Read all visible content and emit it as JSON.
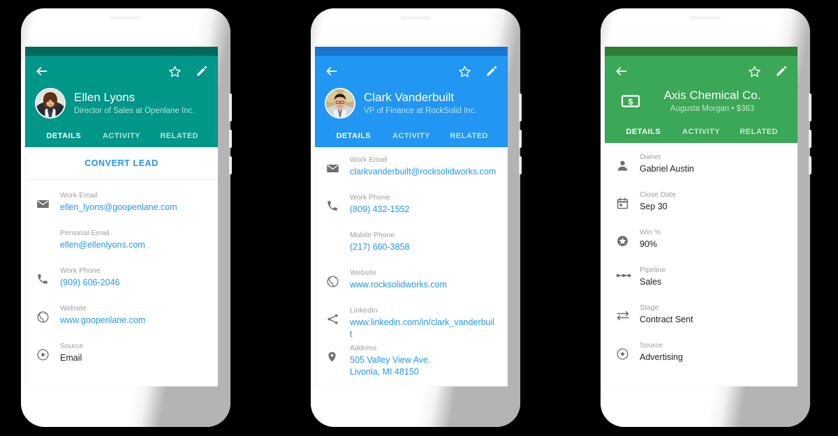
{
  "background_color": "#000000",
  "phones": [
    {
      "id": "lead-ellen-lyons",
      "theme": {
        "primary": "#009688",
        "status_bar": "#00695c"
      },
      "appbar": {
        "back_label": "Back",
        "star_label": "Favorite",
        "edit_label": "Edit"
      },
      "identity": {
        "kind": "avatar",
        "name": "Ellen Lyons",
        "subtitle": "Director of Sales at Openlane Inc."
      },
      "tabs": [
        {
          "label": "DETAILS",
          "active": true
        },
        {
          "label": "ACTIVITY",
          "active": false
        },
        {
          "label": "RELATED",
          "active": false
        }
      ],
      "action_row": {
        "label": "CONVERT LEAD",
        "color": "#2196f3"
      },
      "fields": [
        {
          "icon": "mail-icon",
          "label": "Work Email",
          "value": "ellen_lyons@goopenlane.com",
          "style": "link"
        },
        {
          "icon": "none",
          "label": "Personal Email",
          "value": "ellen@ellenlyons.com",
          "style": "link"
        },
        {
          "icon": "phone-icon",
          "label": "Work Phone",
          "value": "(909) 606-2046",
          "style": "link"
        },
        {
          "icon": "globe-icon",
          "label": "Website",
          "value": "www.goopenlane.com",
          "style": "link"
        },
        {
          "icon": "source-icon",
          "label": "Source",
          "value": "Email",
          "style": "plain"
        }
      ]
    },
    {
      "id": "contact-clark-vanderbuilt",
      "theme": {
        "primary": "#2196f3",
        "status_bar": "#1976d2"
      },
      "appbar": {
        "back_label": "Back",
        "star_label": "Favorite",
        "edit_label": "Edit"
      },
      "identity": {
        "kind": "avatar",
        "name": "Clark Vanderbuilt",
        "subtitle": "VP of Finance at RockSolid Inc."
      },
      "tabs": [
        {
          "label": "DETAILS",
          "active": true
        },
        {
          "label": "ACTIVITY",
          "active": false
        },
        {
          "label": "RELATED",
          "active": false
        }
      ],
      "action_row": null,
      "fields": [
        {
          "icon": "mail-icon",
          "label": "Work Email",
          "value": "clarkvanderbuilt@rocksolidworks.com",
          "style": "link"
        },
        {
          "icon": "phone-icon",
          "label": "Work Phone",
          "value": "(809) 432-1552",
          "style": "link"
        },
        {
          "icon": "none",
          "label": "Mobile Phone",
          "value": "(217) 660-3858",
          "style": "link"
        },
        {
          "icon": "globe-icon",
          "label": "Website",
          "value": "www.rocksolidworks.com",
          "style": "link"
        },
        {
          "icon": "share-icon",
          "label": "LinkedIn",
          "value": "www.linkedin.com/in/clark_vanderbuilt",
          "style": "link"
        },
        {
          "icon": "location-icon",
          "label": "Address",
          "value": "505 Valley View Ave.",
          "value2": "Livonia, MI 48150",
          "style": "link"
        }
      ]
    },
    {
      "id": "deal-axis-chemical",
      "theme": {
        "primary": "#3aa856",
        "status_bar": "#2e7d32"
      },
      "appbar": {
        "back_label": "Back",
        "star_label": "Favorite",
        "edit_label": "Edit"
      },
      "identity": {
        "kind": "deal",
        "icon": "money-icon",
        "name": "Axis Chemical Co.",
        "subtitle": "Augusta Morgan • $363"
      },
      "tabs": [
        {
          "label": "DETAILS",
          "active": true
        },
        {
          "label": "ACTIVITY",
          "active": false
        },
        {
          "label": "RELATED",
          "active": false
        }
      ],
      "action_row": null,
      "fields": [
        {
          "icon": "person-icon",
          "label": "Owner",
          "value": "Gabriel Austin",
          "style": "plain"
        },
        {
          "icon": "calendar-icon",
          "label": "Close Date",
          "value": "Sep 30",
          "style": "plain"
        },
        {
          "icon": "star-circle-icon",
          "label": "Win %",
          "value": "90%",
          "style": "plain"
        },
        {
          "icon": "pipeline-icon",
          "label": "Pipeline",
          "value": "Sales",
          "style": "plain"
        },
        {
          "icon": "stage-icon",
          "label": "Stage",
          "value": "Contract Sent",
          "style": "plain"
        },
        {
          "icon": "source-icon",
          "label": "Source",
          "value": "Advertising",
          "style": "plain"
        }
      ]
    }
  ]
}
